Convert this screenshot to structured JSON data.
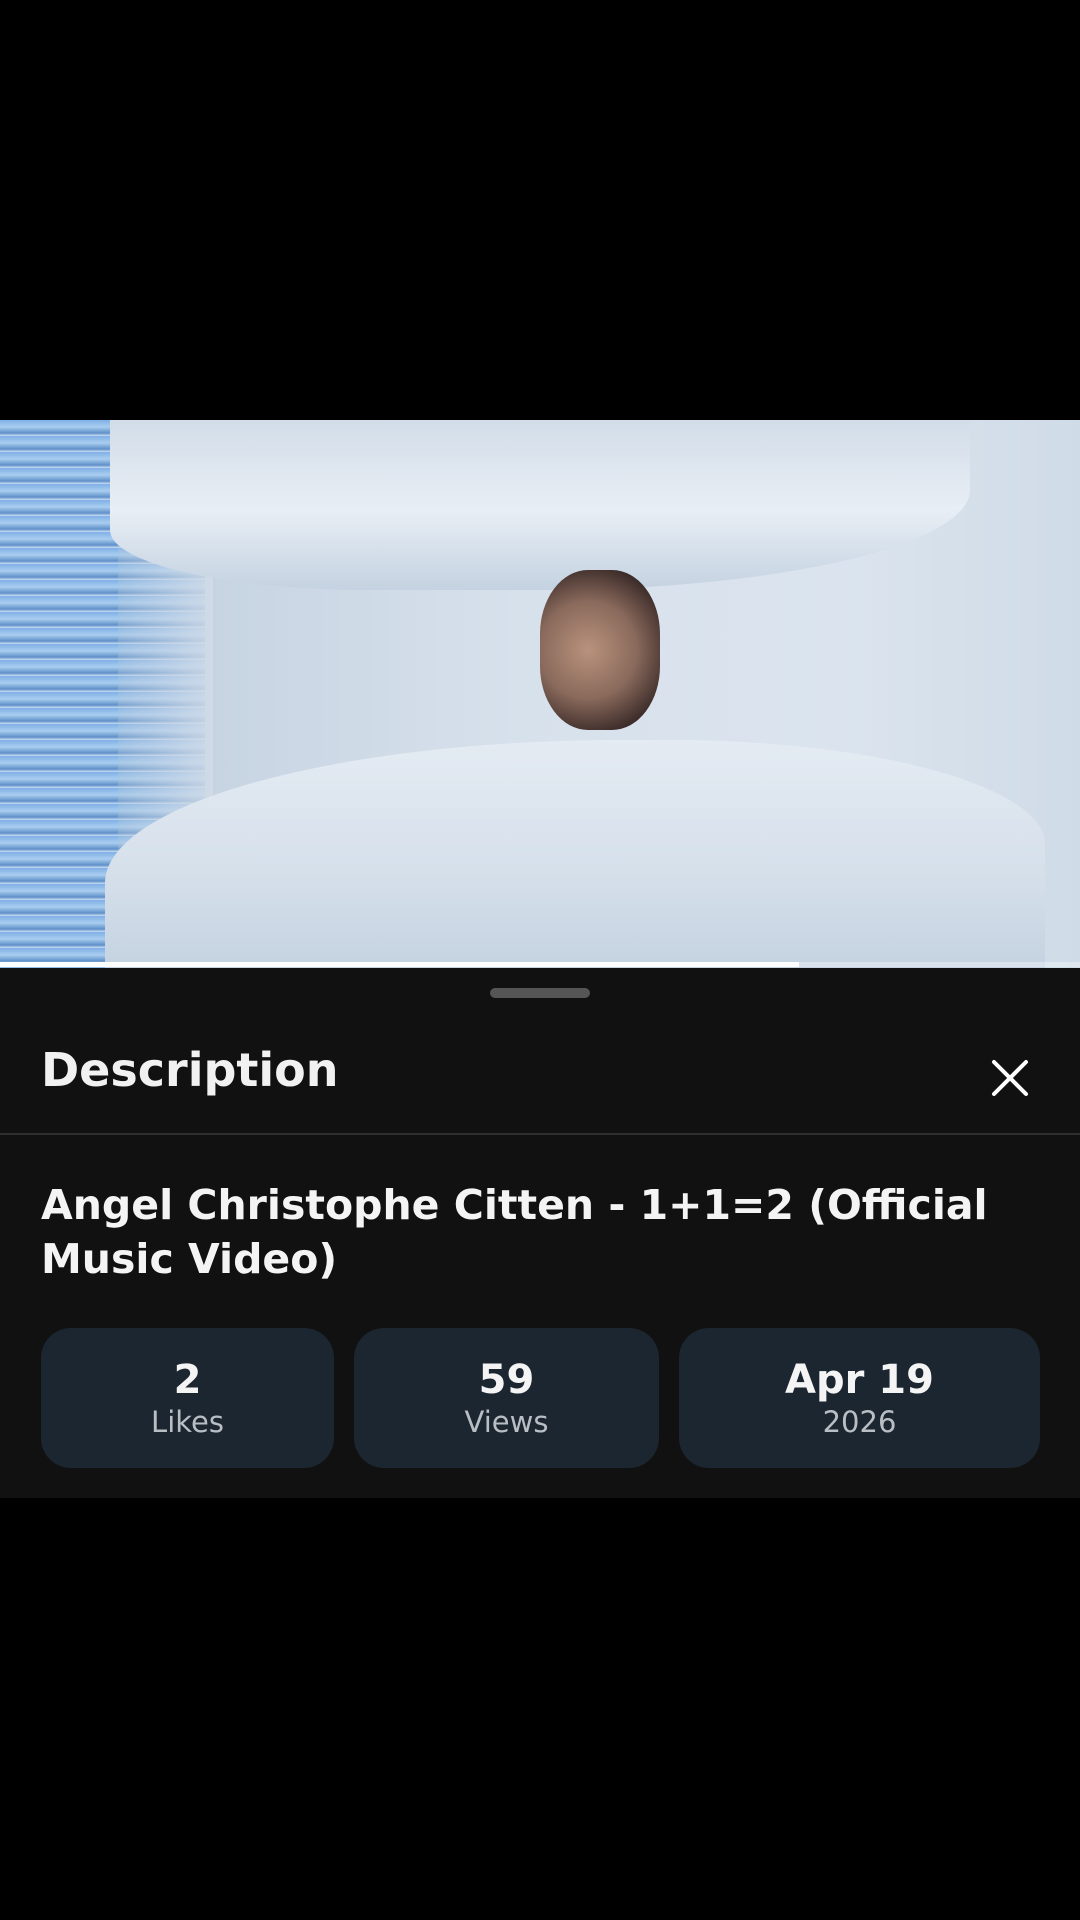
{
  "video": {
    "progress_fraction": 0.74
  },
  "description_sheet": {
    "title": "Description",
    "close_icon": "close-icon",
    "video_title": "Angel Christophe Citten - 1+1=2 (Official Music Video)",
    "stats": [
      {
        "value": "2",
        "label": "Likes"
      },
      {
        "value": "59",
        "label": "Views"
      },
      {
        "value": "Apr 19",
        "label": "2026"
      }
    ]
  },
  "colors": {
    "sheet_background": "#111111",
    "stat_card": "#1c2630",
    "text_primary": "#f4f4f4",
    "text_secondary": "#b9bec4"
  }
}
